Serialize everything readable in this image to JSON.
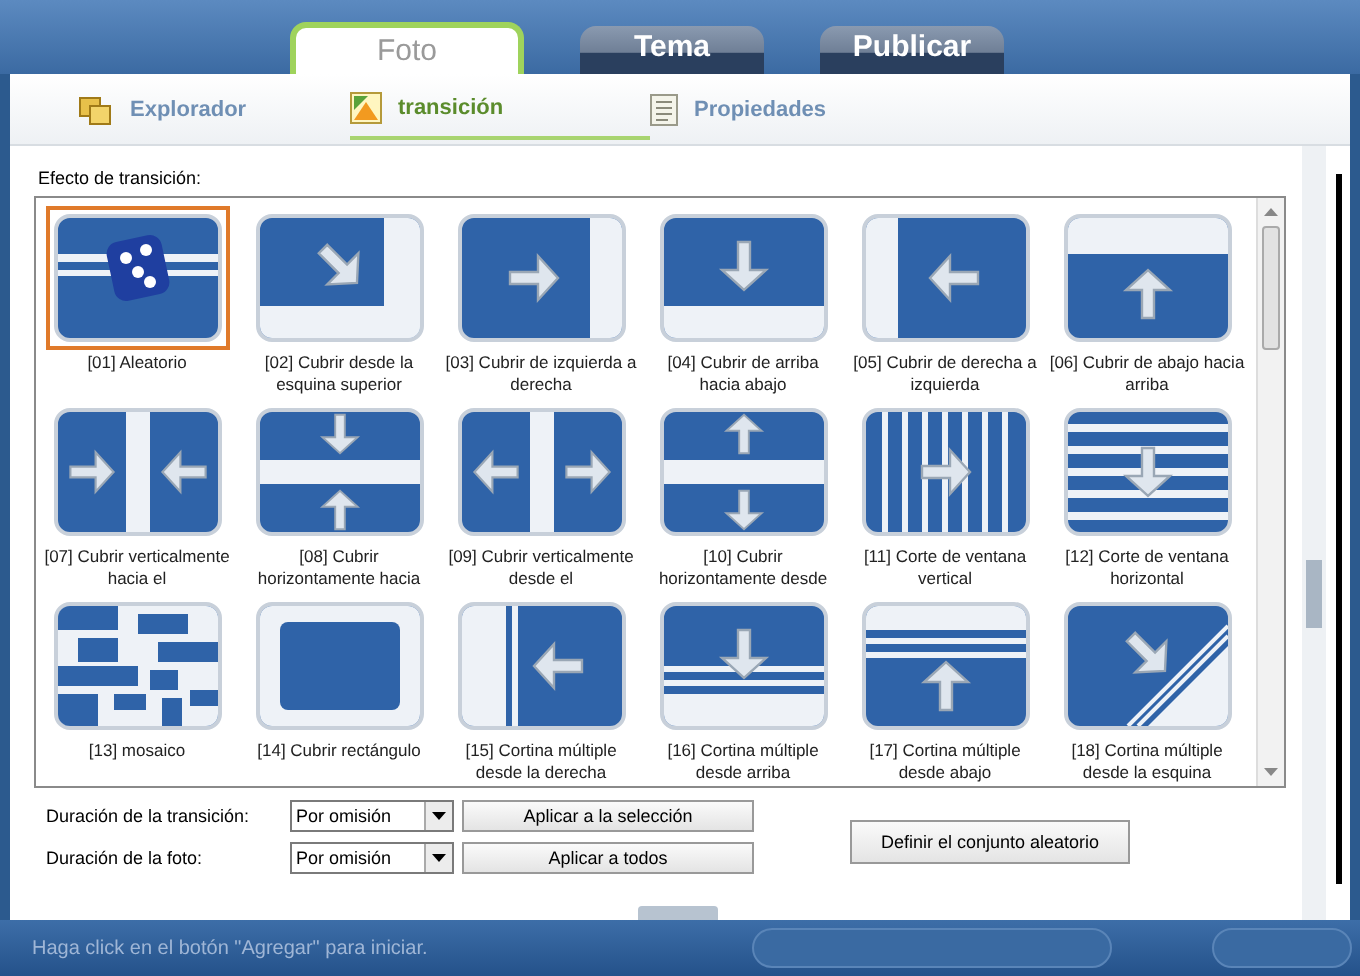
{
  "main_tabs": [
    {
      "label": "Foto",
      "selected": true
    },
    {
      "label": "Tema",
      "selected": false
    },
    {
      "label": "Publicar",
      "selected": false
    }
  ],
  "sub_tabs": [
    {
      "label": "Explorador",
      "selected": false,
      "kind": "folders"
    },
    {
      "label": "transición",
      "selected": true,
      "kind": "image"
    },
    {
      "label": "Propiedades",
      "selected": false,
      "kind": "document"
    }
  ],
  "effects_label": "Efecto de transición:",
  "effects": [
    {
      "label": "[01] Aleatorio",
      "selected": true
    },
    {
      "label": "[02] Cubrir desde la esquina superior",
      "selected": false
    },
    {
      "label": "[03] Cubrir de izquierda a derecha",
      "selected": false
    },
    {
      "label": "[04] Cubrir de arriba hacia abajo",
      "selected": false
    },
    {
      "label": "[05] Cubrir de derecha a izquierda",
      "selected": false
    },
    {
      "label": "[06] Cubrir de abajo hacia arriba",
      "selected": false
    },
    {
      "label": "[07] Cubrir verticalmente hacia el",
      "selected": false
    },
    {
      "label": "[08] Cubrir horizontamente hacia",
      "selected": false
    },
    {
      "label": "[09] Cubrir verticalmente desde el",
      "selected": false
    },
    {
      "label": "[10] Cubrir horizontamente desde",
      "selected": false
    },
    {
      "label": "[11] Corte de ventana vertical",
      "selected": false
    },
    {
      "label": "[12] Corte de ventana horizontal",
      "selected": false
    },
    {
      "label": "[13] mosaico",
      "selected": false
    },
    {
      "label": "[14] Cubrir rectángulo",
      "selected": false
    },
    {
      "label": "[15] Cortina múltiple desde la derecha",
      "selected": false
    },
    {
      "label": "[16] Cortina múltiple desde arriba",
      "selected": false
    },
    {
      "label": "[17] Cortina múltiple desde abajo",
      "selected": false
    },
    {
      "label": "[18] Cortina múltiple desde la esquina",
      "selected": false
    }
  ],
  "durations": [
    {
      "label": "Duración de la transición:",
      "value": "Por omisión",
      "button": "Aplicar a la selección"
    },
    {
      "label": "Duración de la foto:",
      "value": "Por omisión",
      "button": "Aplicar a todos"
    }
  ],
  "random_set_button": "Definir el conjunto aleatorio",
  "status_bar": "Haga click en el botón \"Agregar\" para iniciar."
}
